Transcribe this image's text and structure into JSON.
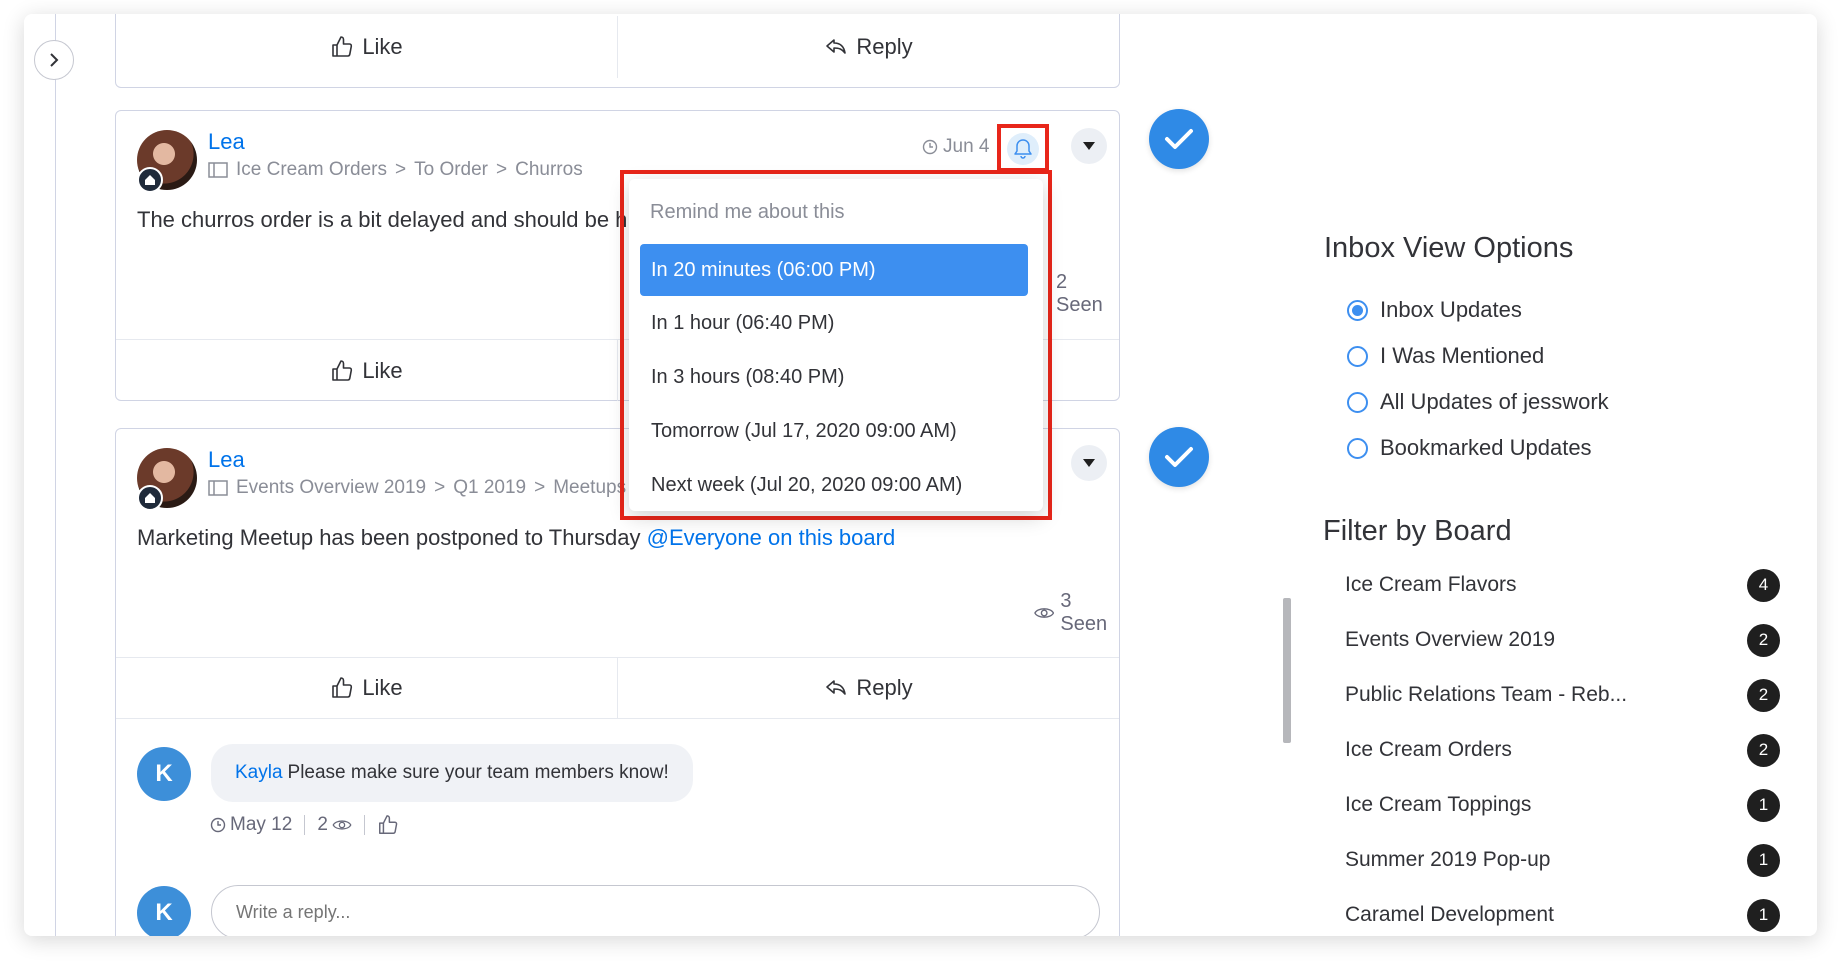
{
  "post_top": {
    "like": "Like",
    "reply": "Reply"
  },
  "post1": {
    "author": "Lea",
    "crumbs": [
      "Ice Cream Orders",
      "To Order",
      "Churros"
    ],
    "date": "Jun 4",
    "message": "The churros order is a bit delayed and should be her",
    "seen": "2 Seen",
    "like": "Like"
  },
  "reminder": {
    "title": "Remind me about this",
    "options": [
      "In 20 minutes (06:00 PM)",
      "In 1 hour (06:40 PM)",
      "In 3 hours (08:40 PM)",
      "Tomorrow (Jul 17, 2020 09:00 AM)",
      "Next week (Jul 20, 2020 09:00 AM)"
    ],
    "selected_index": 0
  },
  "post2": {
    "author": "Lea",
    "crumbs": [
      "Events Overview 2019",
      "Q1 2019",
      "Meetups"
    ],
    "message": "Marketing Meetup has been postponed to Thursday",
    "mention": "@Everyone on this board",
    "seen": "3 Seen",
    "like": "Like",
    "reply": "Reply",
    "comment": {
      "avatar_letter": "K",
      "author": "Kayla",
      "text": "Please make sure your team members know!",
      "date": "May 12",
      "views": "2"
    },
    "reply_avatar_letter": "K",
    "reply_placeholder": "Write a reply..."
  },
  "sidebar": {
    "view_options_title": "Inbox View Options",
    "view_options": [
      {
        "label": "Inbox Updates",
        "checked": true
      },
      {
        "label": "I Was Mentioned",
        "checked": false
      },
      {
        "label": "All Updates of jesswork",
        "checked": false
      },
      {
        "label": "Bookmarked Updates",
        "checked": false
      }
    ],
    "filter_title": "Filter by Board",
    "boards": [
      {
        "name": "Ice Cream Flavors",
        "count": "4"
      },
      {
        "name": "Events Overview 2019",
        "count": "2"
      },
      {
        "name": "Public Relations Team - Reb...",
        "count": "2"
      },
      {
        "name": "Ice Cream Orders",
        "count": "2"
      },
      {
        "name": "Ice Cream Toppings",
        "count": "1"
      },
      {
        "name": "Summer 2019 Pop-up",
        "count": "1"
      },
      {
        "name": "Caramel Development",
        "count": "1"
      }
    ]
  },
  "colors": {
    "accent": "#0073ea",
    "highlight": "#e8261a",
    "check": "#2f8ae6"
  }
}
